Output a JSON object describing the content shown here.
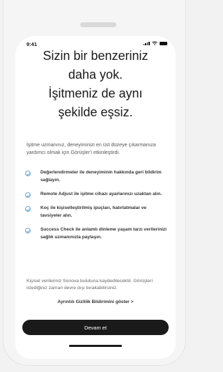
{
  "status": {
    "time": "9:41"
  },
  "headline": [
    "Sizin bir benzeriniz",
    "daha yok.",
    "İşitmeniz de aynı",
    "şekilde eşsiz."
  ],
  "intro": "İşitme uzmanınız, deneyiminizi en üst düzeye çıkarmanıza yardımcı olmak için Görüşler'i etkinleştirdi.",
  "features": [
    "Değerlendirmeler ile deneyiminin hakkında geri bildirim sağlayın.",
    "Remote Adjust ile işitme cihazı ayarlarınızı uzaktan alın.",
    "Koç ile kişiselleştirilmiş ipuçları, hatırlatmalar ve tavsiyeler alın.",
    "Success Check ile anlamlı dinleme yaşam tarzı verilerinizi sağlık uzmanınızla paylaşın."
  ],
  "privacy_text": "Kişisel verileriniz Sonova bulutuna kaydedilecektir. Görüşleri istediğiniz zaman devre dışı bırakabilirsiniz.",
  "privacy_link": "Ayrıntılı Gizlilik Bildirimini göster >",
  "continue_label": "Devam et",
  "colors": {
    "accent": "#6aa9d6",
    "button": "#1a1a1a"
  }
}
